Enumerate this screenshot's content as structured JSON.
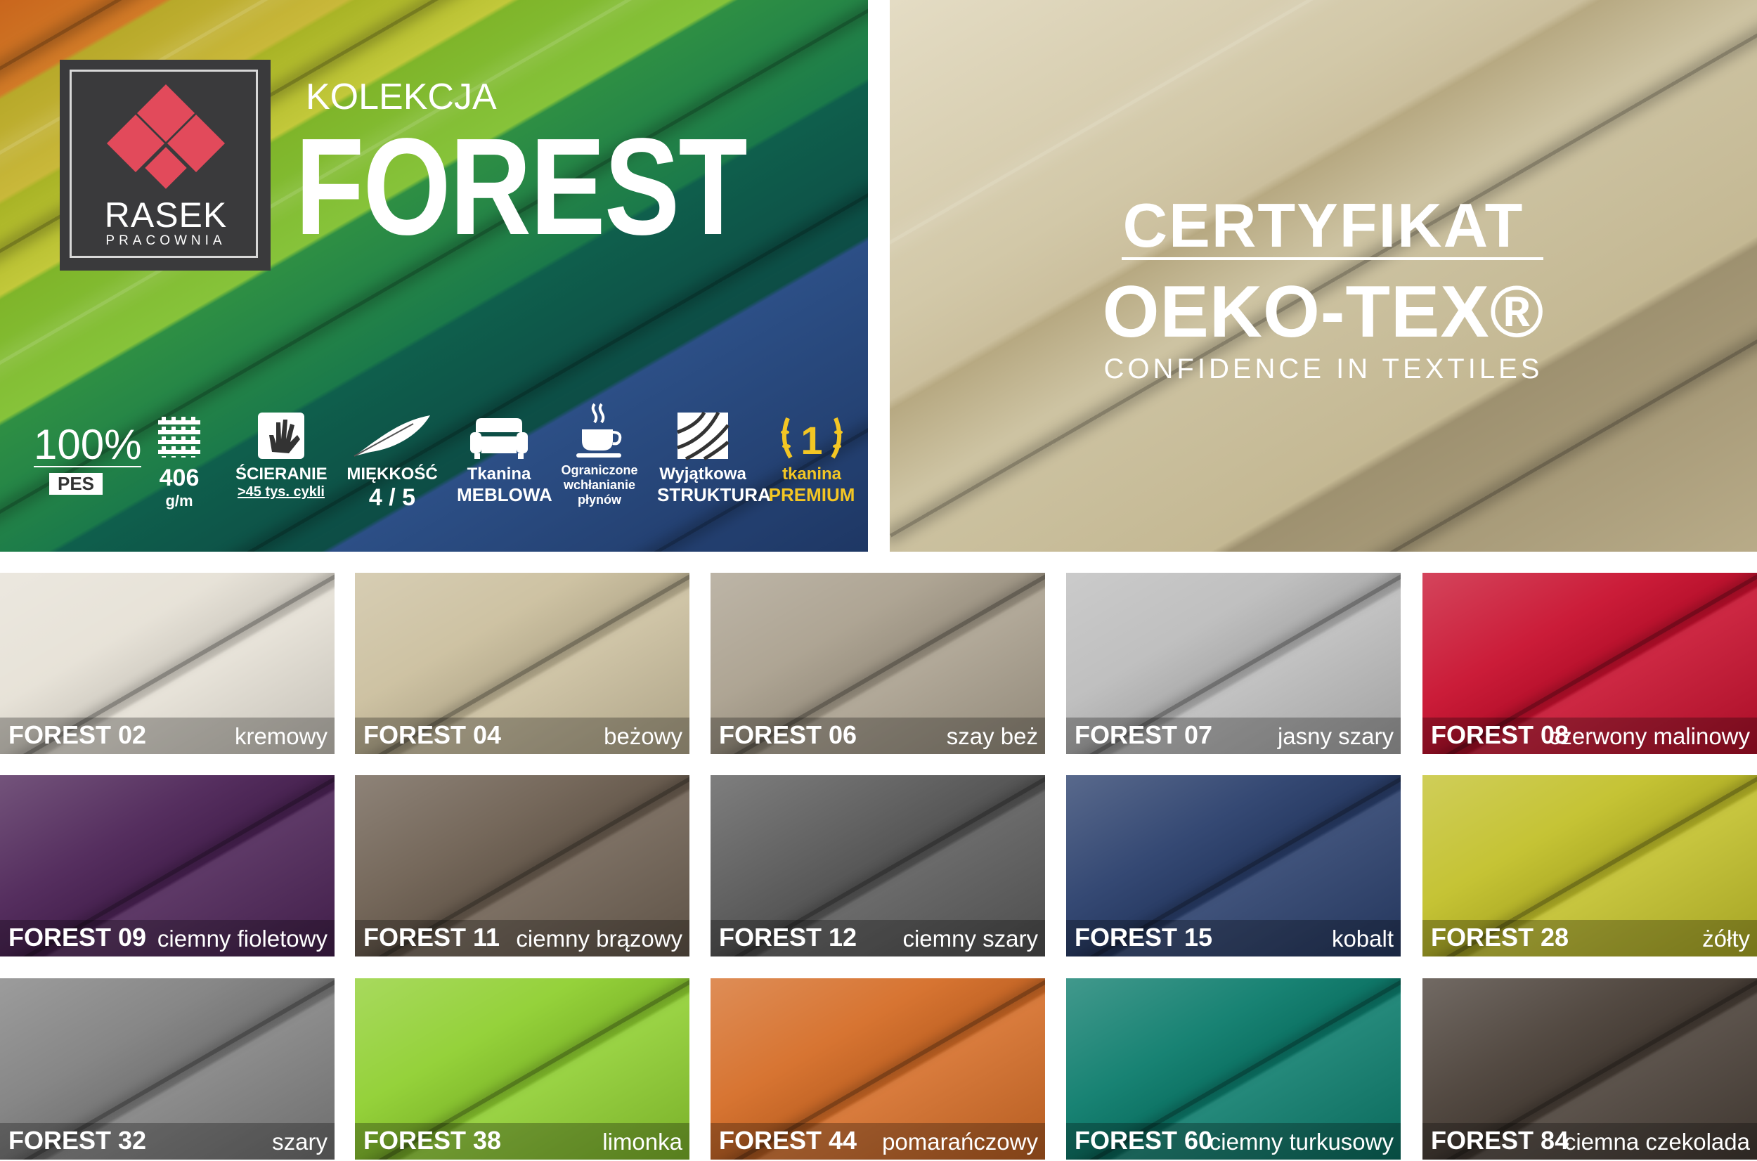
{
  "brand": {
    "name": "RASEK",
    "sub": "PRACOWNIA"
  },
  "collection": {
    "label": "KOLEKCJA",
    "name": "FOREST"
  },
  "features": [
    {
      "icon": "pes-icon",
      "value": "100%",
      "tag": "PES"
    },
    {
      "icon": "weave-icon",
      "line1": "406",
      "line2": "g/m"
    },
    {
      "icon": "hand-icon",
      "line1": "ŚCIERANIE",
      "line2": ">45 tys. cykli"
    },
    {
      "icon": "feather-icon",
      "line1": "MIĘKKOŚĆ",
      "line2": "4 / 5"
    },
    {
      "icon": "armchair-icon",
      "line1": "Tkanina",
      "line2": "MEBLOWA"
    },
    {
      "icon": "cup-icon",
      "line1": "Ograniczone",
      "line2": "wchłanianie",
      "line3": "płynów"
    },
    {
      "icon": "texture-icon",
      "line1": "Wyjątkowa",
      "line2": "STRUKTURA"
    },
    {
      "icon": "premium-icon",
      "badge": "1",
      "line1": "tkanina",
      "line2": "PREMIUM"
    }
  ],
  "certificate": {
    "line1": "CERTYFIKAT",
    "line2": "OEKO-TEX®",
    "line3": "CONFIDENCE IN TEXTILES"
  },
  "swatches": [
    {
      "code": "FOREST 02",
      "name": "kremowy",
      "color": "#e6e1d6"
    },
    {
      "code": "FOREST 04",
      "name": "beżowy",
      "color": "#cbbf9e"
    },
    {
      "code": "FOREST 06",
      "name": "szay beż",
      "color": "#aaa08e"
    },
    {
      "code": "FOREST 07",
      "name": "jasny szary",
      "color": "#bcbcbc"
    },
    {
      "code": "FOREST 08",
      "name": "czerwony malinowy",
      "color": "#c8102e"
    },
    {
      "code": "FOREST 09",
      "name": "ciemny fioletowy",
      "color": "#4c2356"
    },
    {
      "code": "FOREST 11",
      "name": "ciemny brązowy",
      "color": "#6e6052"
    },
    {
      "code": "FOREST 12",
      "name": "ciemny szary",
      "color": "#5a5a5a"
    },
    {
      "code": "FOREST 15",
      "name": "kobalt",
      "color": "#2a3f6c"
    },
    {
      "code": "FOREST 28",
      "name": "żółty",
      "color": "#c2c02a"
    },
    {
      "code": "FOREST 32",
      "name": "szary",
      "color": "#808080"
    },
    {
      "code": "FOREST 38",
      "name": "limonka",
      "color": "#8fcf30"
    },
    {
      "code": "FOREST 44",
      "name": "pomarańczowy",
      "color": "#d56d27"
    },
    {
      "code": "FOREST 60",
      "name": "ciemny turkusowy",
      "color": "#0c7c6c"
    },
    {
      "code": "FOREST 84",
      "name": "ciemna czekolada",
      "color": "#4a4038"
    }
  ]
}
